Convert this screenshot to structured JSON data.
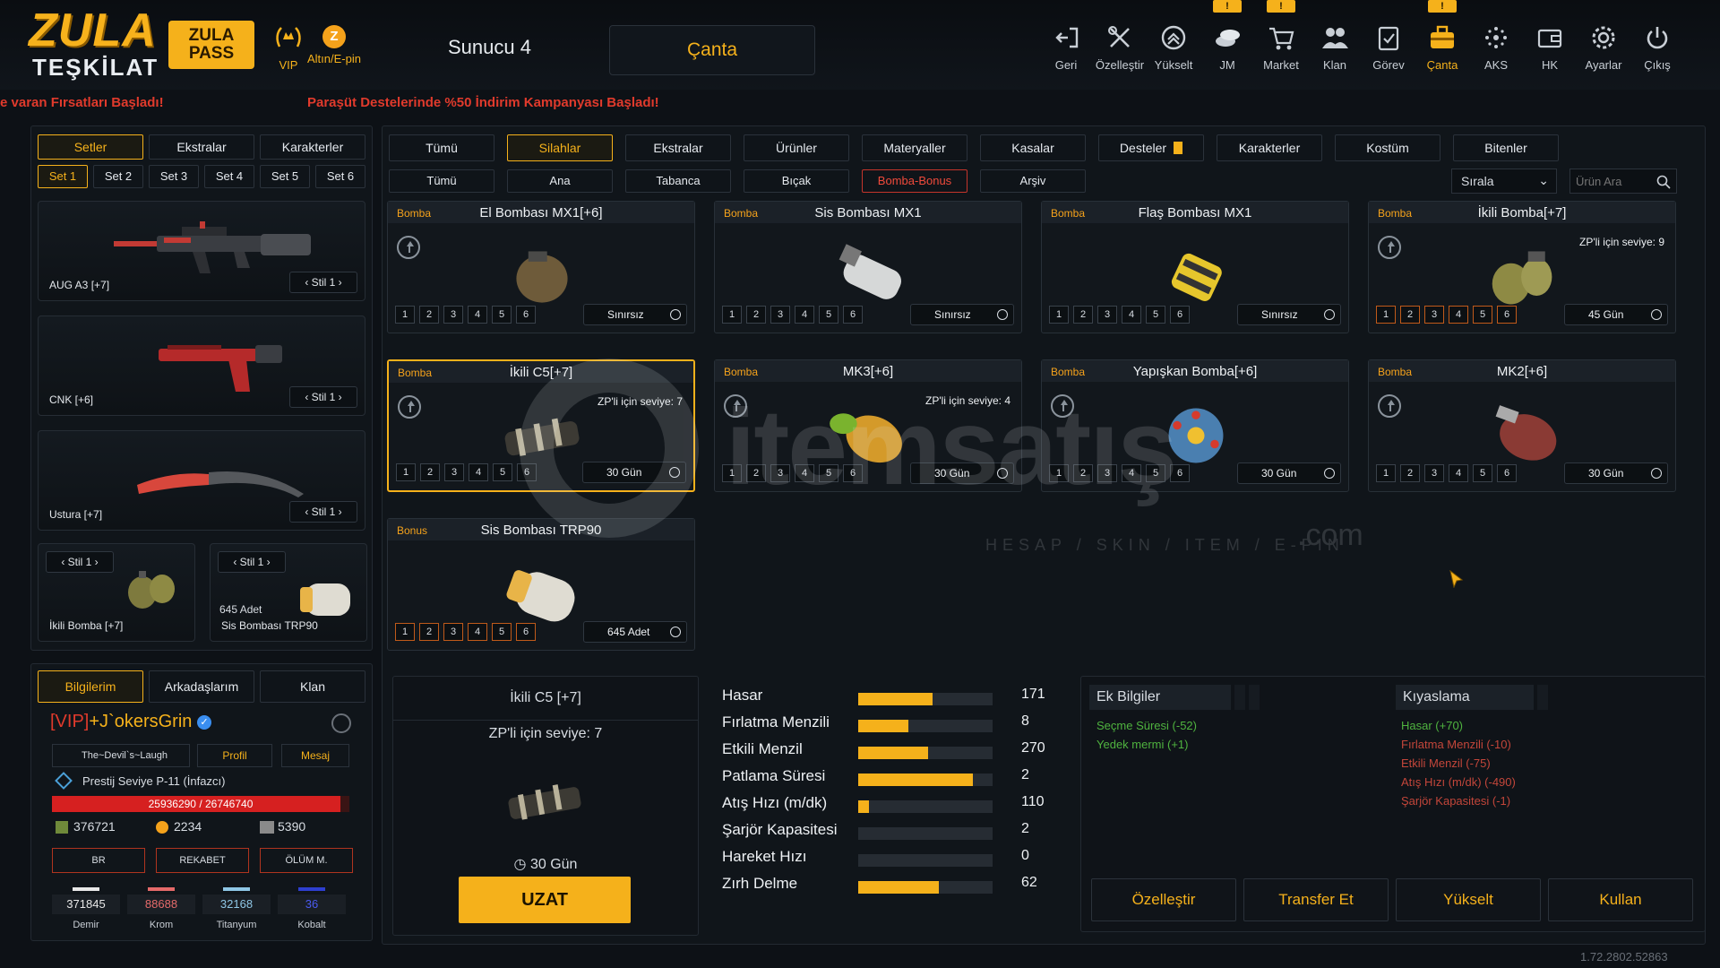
{
  "brand": {
    "logo_top": "ZULA",
    "logo_bottom": "TEŞKİLAT",
    "pass_label": "ZULA\nPASS",
    "vip_label": "VIP",
    "altin_label": "Altın/E-pin",
    "server": "Sunucu 4",
    "screen_title": "Çanta"
  },
  "nav": [
    {
      "label": "Geri",
      "icon": "back-icon",
      "badge": ""
    },
    {
      "label": "Özelleştir",
      "icon": "tools-icon",
      "badge": ""
    },
    {
      "label": "Yükselt",
      "icon": "upgrade-icon",
      "badge": ""
    },
    {
      "label": "JM",
      "icon": "coins-icon",
      "badge": "!"
    },
    {
      "label": "Market",
      "icon": "cart-icon",
      "badge": "!"
    },
    {
      "label": "Klan",
      "icon": "clan-icon",
      "badge": ""
    },
    {
      "label": "Görev",
      "icon": "task-icon",
      "badge": ""
    },
    {
      "label": "Çanta",
      "icon": "bag-icon",
      "badge": "!"
    },
    {
      "label": "AKS",
      "icon": "aks-icon",
      "badge": ""
    },
    {
      "label": "HK",
      "icon": "wallet-icon",
      "badge": ""
    },
    {
      "label": "Ayarlar",
      "icon": "gear-icon",
      "badge": ""
    },
    {
      "label": "Çıkış",
      "icon": "power-icon",
      "badge": ""
    }
  ],
  "tickers": [
    "e varan Fırsatları Başladı!",
    "Paraşüt Destelerinde %50 İndirim Kampanyası Başladı!"
  ],
  "left_tabs": [
    "Setler",
    "Ekstralar",
    "Karakterler"
  ],
  "set_tabs": [
    "Set 1",
    "Set 2",
    "Set 3",
    "Set 4",
    "Set 5",
    "Set 6"
  ],
  "loadout": {
    "primary": {
      "name": "AUG A3 [+7]",
      "style": "Stil 1"
    },
    "secondary": {
      "name": "CNK [+6]",
      "style": "Stil 1"
    },
    "melee": {
      "name": "Ustura [+7]",
      "style": "Stil 1"
    },
    "grenade1": {
      "name": "İkili Bomba [+7]",
      "style": "Stil 1"
    },
    "grenade2": {
      "name": "Sis Bombası TRP90",
      "style": "Stil 1",
      "count": "645 Adet"
    }
  },
  "profile": {
    "tabs": [
      "Bilgilerim",
      "Arkadaşlarım",
      "Klan"
    ],
    "vip_tag": "[VIP]",
    "name": "+J`okersGrin",
    "clan": "The~Devil`s~Laugh",
    "profile_btn": "Profil",
    "message_btn": "Mesaj",
    "prestige": "Prestij Seviye P-11 (İnfazcı)",
    "xp_text": "25936290 / 26746740",
    "xp_progress": 0.97,
    "currency1": "376721",
    "currency2": "2234",
    "currency3": "5390",
    "modes": [
      "BR",
      "REKABET",
      "ÖLÜM M."
    ],
    "materials": [
      {
        "value": "371845",
        "label": "Demir",
        "color": "#e8e8e8"
      },
      {
        "value": "88688",
        "label": "Krom",
        "color": "#e56a6a"
      },
      {
        "value": "32168",
        "label": "Titanyum",
        "color": "#8fc7e6"
      },
      {
        "value": "36",
        "label": "Kobalt",
        "color": "#2e3fd0"
      }
    ]
  },
  "main_tabs": [
    "Tümü",
    "Silahlar",
    "Ekstralar",
    "Ürünler",
    "Materyaller",
    "Kasalar",
    "Desteler",
    "Karakterler",
    "Kostüm",
    "Bitenler"
  ],
  "sub_tabs": [
    "Tümü",
    "Ana",
    "Tabanca",
    "Bıçak",
    "Bomba-Bonus",
    "Arşiv"
  ],
  "sort_label": "Sırala",
  "search_placeholder": "Ürün Ara",
  "items": [
    {
      "type": "Bomba",
      "name": "El Bombası MX1[+6]",
      "note": "",
      "dur": "Sınırsız",
      "lit": false,
      "art": "frag"
    },
    {
      "type": "Bomba",
      "name": "Sis Bombası MX1",
      "note": "",
      "dur": "Sınırsız",
      "lit": false,
      "art": "smoke"
    },
    {
      "type": "Bomba",
      "name": "Flaş Bombası MX1",
      "note": "",
      "dur": "Sınırsız",
      "lit": false,
      "art": "flash"
    },
    {
      "type": "Bomba",
      "name": "İkili Bomba[+7]",
      "note": "ZP'li için seviye: 9",
      "dur": "45 Gün",
      "lit": true,
      "art": "dual"
    },
    {
      "type": "Bomba",
      "name": "İkili C5[+7]",
      "note": "ZP'li için seviye: 7",
      "dur": "30 Gün",
      "lit": false,
      "art": "c5"
    },
    {
      "type": "Bomba",
      "name": "MK3[+6]",
      "note": "ZP'li için seviye: 4",
      "dur": "30 Gün",
      "lit": false,
      "art": "mk3"
    },
    {
      "type": "Bomba",
      "name": "Yapışkan Bomba[+6]",
      "note": "",
      "dur": "30 Gün",
      "lit": false,
      "art": "sticky"
    },
    {
      "type": "Bomba",
      "name": "MK2[+6]",
      "note": "",
      "dur": "30 Gün",
      "lit": false,
      "art": "mk2"
    },
    {
      "type": "Bonus",
      "name": "Sis Bombası TRP90",
      "note": "",
      "dur": "645 Adet",
      "lit": true,
      "art": "trp"
    }
  ],
  "slots": [
    "1",
    "2",
    "3",
    "4",
    "5",
    "6"
  ],
  "detail": {
    "name": "İkili C5 [+7]",
    "req": "ZP'li için seviye: 7",
    "duration": "30 Gün",
    "extend_btn": "UZAT"
  },
  "stats": [
    {
      "label": "Hasar",
      "value": "171",
      "fill": 0.55
    },
    {
      "label": "Fırlatma Menzili",
      "value": "8",
      "fill": 0.37
    },
    {
      "label": "Etkili Menzil",
      "value": "270",
      "fill": 0.52
    },
    {
      "label": "Patlama Süresi",
      "value": "2",
      "fill": 0.85
    },
    {
      "label": "Atış Hızı (m/dk)",
      "value": "110",
      "fill": 0.08
    },
    {
      "label": "Şarjör Kapasitesi",
      "value": "2",
      "fill": 0
    },
    {
      "label": "Hareket Hızı",
      "value": "0",
      "fill": 0
    },
    {
      "label": "Zırh Delme",
      "value": "62",
      "fill": 0.6
    }
  ],
  "extra_info": {
    "title": "Ek Bilgiler",
    "lines": [
      "Seçme Süresi (-52)",
      "Yedek mermi (+1)"
    ]
  },
  "compare": {
    "title": "Kıyaslama",
    "lines": [
      {
        "text": "Hasar (+70)",
        "good": true
      },
      {
        "text": "Fırlatma Menzili (-10)",
        "good": false
      },
      {
        "text": "Etkili Menzil (-75)",
        "good": false
      },
      {
        "text": "Atış Hızı (m/dk) (-490)",
        "good": false
      },
      {
        "text": "Şarjör Kapasitesi (-1)",
        "good": false
      }
    ]
  },
  "actions": [
    "Özelleştir",
    "Transfer Et",
    "Yükselt",
    "Kullan"
  ],
  "watermark": {
    "main": "itemsatış",
    "sub": "HESAP / SKIN / ITEM / E-PIN",
    "com": ".com"
  },
  "version": "1.72.2802.52863",
  "colors": {
    "accent": "#f5b11b",
    "red": "#e03a2c",
    "green": "#4fb33f"
  }
}
